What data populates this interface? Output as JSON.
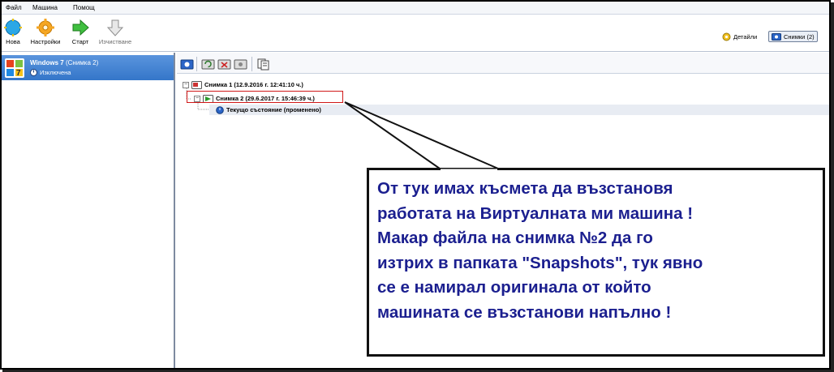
{
  "menu": {
    "items": [
      "Файл",
      "Машина",
      "Помощ"
    ]
  },
  "toolbar": {
    "new_label": "Нова",
    "settings_label": "Настройки",
    "start_label": "Старт",
    "discard_label": "Изчистване",
    "details_label": "Детайли",
    "snapshots_label": "Снимки (2)"
  },
  "vm": {
    "name": "Windows 7",
    "snapshot_suffix": "(Снимка 2)",
    "state": "Изключена"
  },
  "snapshots": {
    "items": [
      {
        "label": "Снимка 1 (12.9.2016 г. 12:41:10 ч.)"
      },
      {
        "label": "Снимка 2 (29.6.2017 г. 15:46:39 ч.)"
      },
      {
        "label": "Текущо състояние (променено)"
      }
    ]
  },
  "callout": {
    "lines": [
      "От тук имах късмета да възстановя",
      "работата на Виртуалната ми машина !",
      "Макар файла на снимка №2 да го",
      "изтрих в папката \"Snapshots\", тук явно",
      "се е намирал оригинала от който",
      "машината се възстанови напълно !"
    ]
  },
  "colors": {
    "selection": "#3476c9",
    "callout_text": "#1b1f8f",
    "highlight_box": "#d01818"
  }
}
